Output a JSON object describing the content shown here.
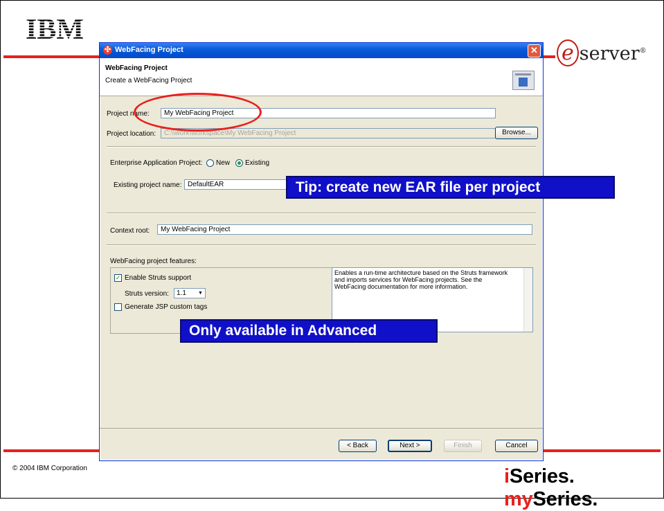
{
  "slide": {
    "logo_text": "IBM",
    "eserver_e": "e",
    "eserver_rest": "server",
    "eserver_reg": "®",
    "copyright": "© 2004 IBM Corporation",
    "brand_i": "i",
    "brand_series": "Series.",
    "brand_my": "my",
    "brand_series2": "Series.",
    "accent_color": "#e8201d"
  },
  "window": {
    "title": "WebFacing Project",
    "header_title": "WebFacing Project",
    "header_subtitle": "Create a WebFacing Project",
    "project_name_label": "Project name:",
    "project_name_value": "My WebFacing Project",
    "project_location_label": "Project location:",
    "project_location_value": "C:\\\\work\\workspace\\My WebFacing Project",
    "browse_label": "Browse...",
    "ear_label": "Enterprise Application Project:",
    "ear_new_label": "New",
    "ear_existing_label": "Existing",
    "ear_selected": "Existing",
    "existing_name_label": "Existing project name:",
    "existing_name_value": "DefaultEAR",
    "context_root_label": "Context root:",
    "context_root_value": "My WebFacing Project",
    "features_label": "WebFacing project features:",
    "enable_struts_label": "Enable Struts support",
    "enable_struts_checked": true,
    "struts_version_label": "Struts version:",
    "struts_version_value": "1.1",
    "jsp_tags_label": "Generate JSP custom tags",
    "jsp_tags_checked": false,
    "description": "Enables a run-time architecture based on the Struts framework and imports services for WebFacing projects. See the WebFacing documentation for more information.",
    "back_label": "< Back",
    "next_label": "Next >",
    "finish_label": "Finish",
    "cancel_label": "Cancel"
  },
  "callouts": {
    "tip": "Tip: create new EAR file per project",
    "advanced": "Only available in Advanced"
  }
}
